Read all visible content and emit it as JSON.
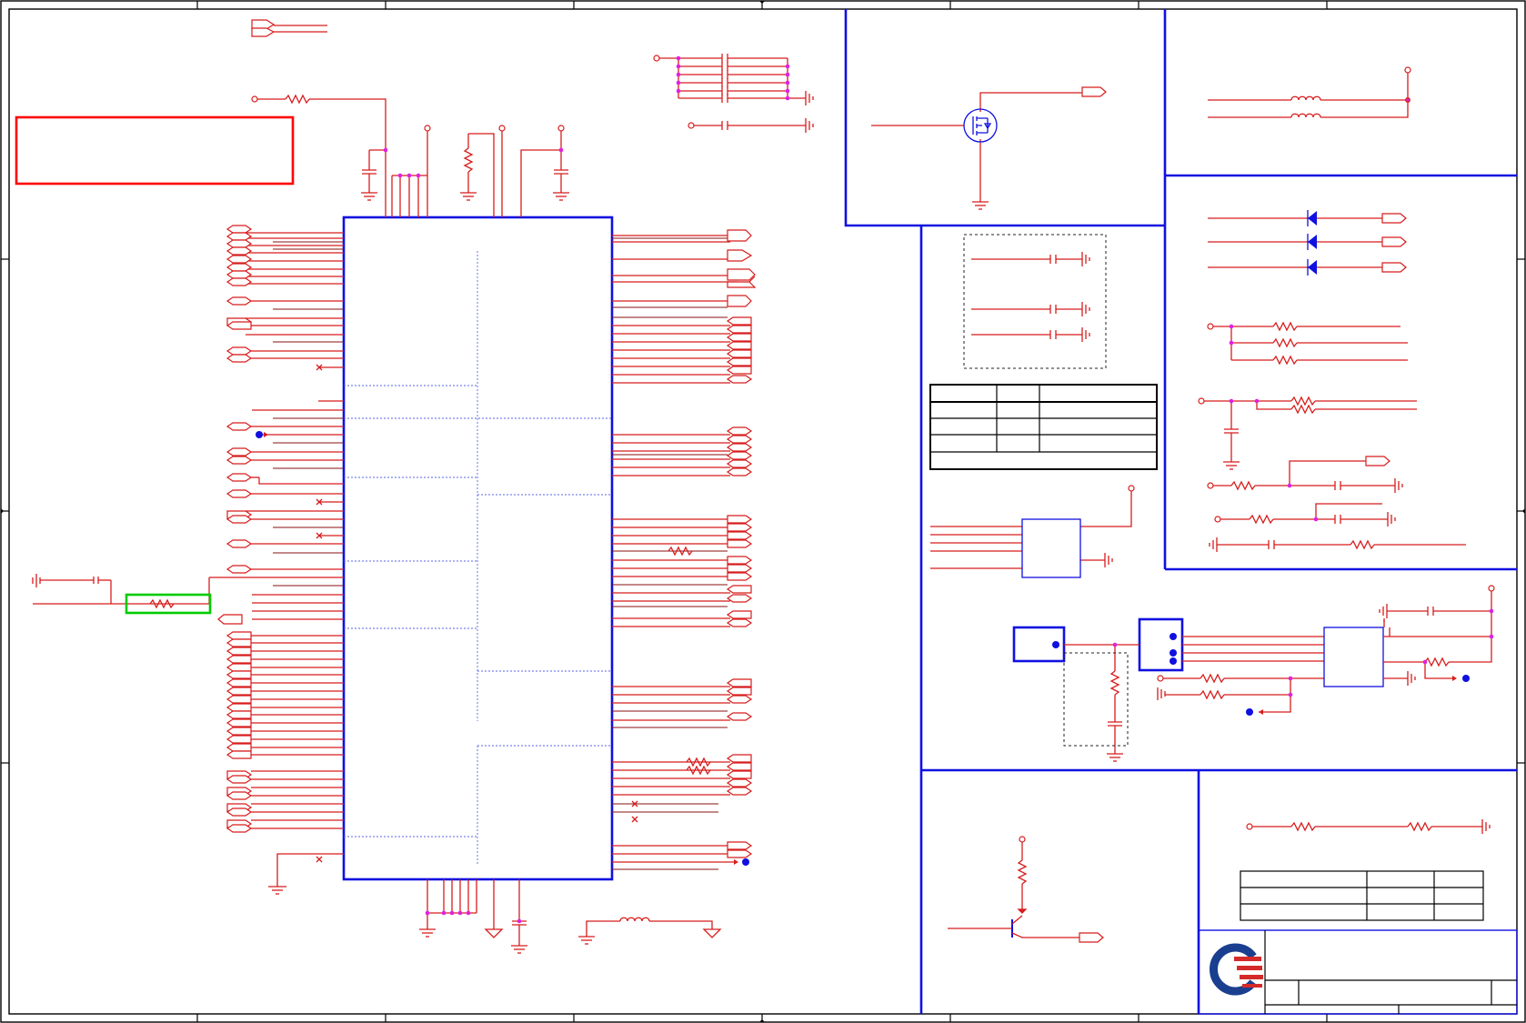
{
  "sheet": {
    "kind": "schematic",
    "ink": {
      "wire": "#d81c1c",
      "component": "#1010e0",
      "frame": "#000000",
      "junction": "#e020e0",
      "note_box": "#ff0000",
      "highlight_box": "#00cc00"
    },
    "logo": {
      "colors": [
        "#1a3f8f",
        "#d42a2a"
      ]
    },
    "text": []
  }
}
